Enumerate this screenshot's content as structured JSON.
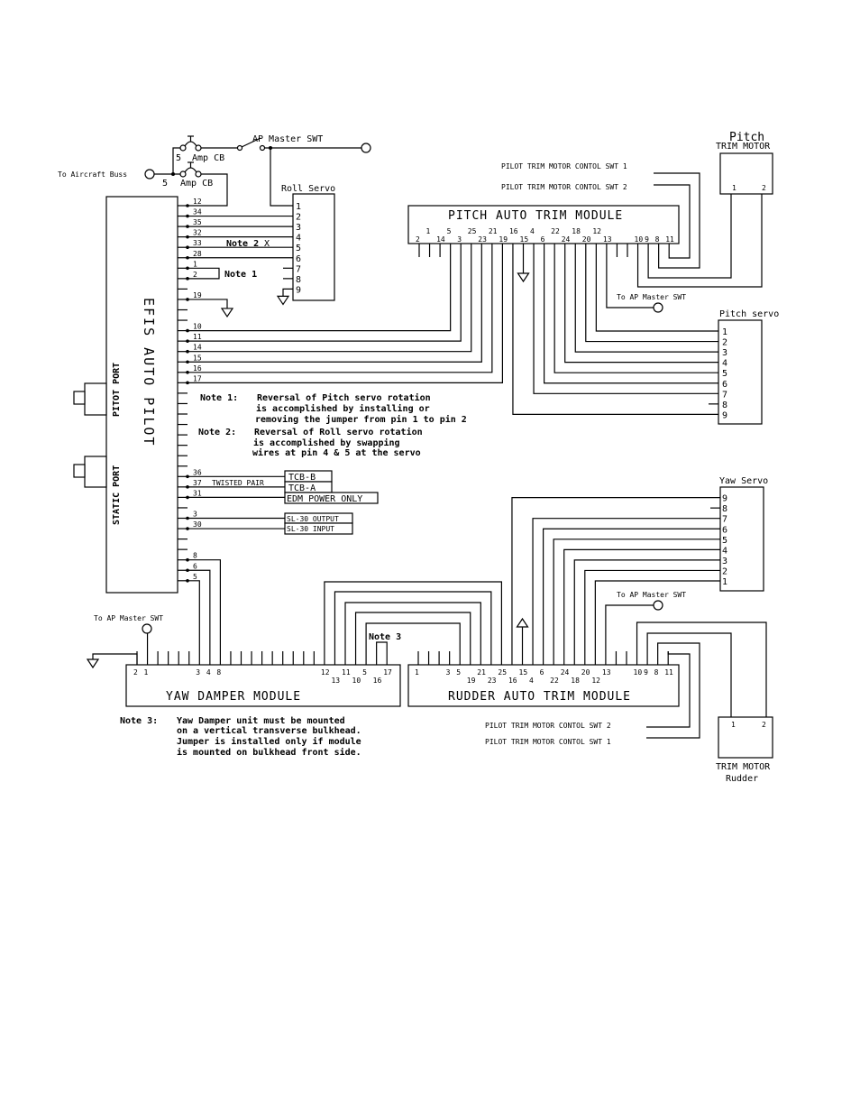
{
  "power": {
    "aircraft_buss": "To Aircraft Buss",
    "cb_top_amps": "5",
    "cb_top_label": "Amp CB",
    "cb_bottom_amps": "5",
    "cb_bottom_label": "Amp CB",
    "ap_master": "AP Master SWT"
  },
  "efis": {
    "title": "EFIS AUTO PILOT",
    "pitot_port": "PITOT PORT",
    "static_port": "STATIC PORT",
    "pins": [
      "12",
      "34",
      "35",
      "32",
      "33",
      "28",
      "1",
      "2",
      "",
      "19",
      "",
      "",
      "10",
      "11",
      "14",
      "15",
      "16",
      "17",
      "",
      "",
      "",
      "",
      "",
      "",
      "",
      "",
      "36",
      "37",
      "31",
      "",
      "3",
      "30",
      "",
      "",
      "8",
      "6",
      "5"
    ]
  },
  "roll_servo": {
    "title": "Roll Servo",
    "pins": [
      "1",
      "2",
      "3",
      "4",
      "5",
      "6",
      "7",
      "8",
      "9"
    ]
  },
  "inline_notes": {
    "note1": "Note 1",
    "note2": "Note 2",
    "note3": "Note 3"
  },
  "pitch_module": {
    "title": "PITCH AUTO TRIM MODULE",
    "pins": [
      "2",
      "1",
      "14",
      "5",
      "3",
      "25",
      "23",
      "21",
      "19",
      "16",
      "15",
      "4",
      "6",
      "22",
      "24",
      "18",
      "20",
      "12",
      "13",
      "",
      "",
      "10",
      "9",
      "8",
      "11"
    ]
  },
  "pitch_trim_motor": {
    "title": "Pitch",
    "subtitle": "TRIM MOTOR",
    "pins": [
      "1",
      "2"
    ]
  },
  "pitch_switches": {
    "swt1": "PILOT TRIM MOTOR CONTOL SWT 1",
    "swt2": "PILOT TRIM MOTOR CONTOL SWT 2"
  },
  "to_ap_master": {
    "pitch": "To AP Master SWT",
    "yaw_damper": "To AP Master SWT",
    "rudder": "To AP Master SWT"
  },
  "pitch_servo": {
    "title": "Pitch servo",
    "pins": [
      "1",
      "2",
      "3",
      "4",
      "5",
      "6",
      "7",
      "8",
      "9"
    ]
  },
  "notes": {
    "note1_label": "Note 1:",
    "note1_lines": [
      "Reversal of Pitch servo rotation",
      "is accomplished by installing or",
      "removing the jumper from pin 1 to pin 2"
    ],
    "note2_label": "Note 2:",
    "note2_lines": [
      "Reversal of Roll servo rotation",
      "is accomplished by swapping",
      "wires at pin 4 & 5 at the servo"
    ],
    "note3_label": "Note 3:",
    "note3_lines": [
      "Yaw Damper unit must be mounted",
      "on a vertical transverse bulkhead.",
      "Jumper is installed only if module",
      "is mounted on bulkhead front side."
    ]
  },
  "connections": {
    "twisted_pair": "TWISTED PAIR",
    "tcb_b": "TCB-B",
    "tcb_a": "TCB-A",
    "edm": "EDM POWER ONLY",
    "sl30_out": "SL-30 OUTPUT",
    "sl30_in": "SL-30 INPUT"
  },
  "yaw_servo": {
    "title": "Yaw Servo",
    "pins": [
      "9",
      "8",
      "7",
      "6",
      "5",
      "4",
      "3",
      "2",
      "1"
    ]
  },
  "yaw_damper": {
    "title": "YAW DAMPER MODULE",
    "pins": [
      "2",
      "1",
      "",
      "",
      "",
      "",
      "3",
      "4",
      "8",
      "",
      "",
      "",
      "",
      "",
      "",
      "",
      "",
      "",
      "12",
      "13",
      "11",
      "10",
      "5",
      "16",
      "17"
    ]
  },
  "rudder_module": {
    "title": "RUDDER AUTO TRIM MODULE",
    "pins": [
      "1",
      "",
      "",
      "3",
      "5",
      "19",
      "21",
      "23",
      "25",
      "16",
      "15",
      "4",
      "6",
      "22",
      "24",
      "18",
      "20",
      "12",
      "13",
      "",
      "",
      "10",
      "9",
      "8",
      "11"
    ]
  },
  "rudder_switches": {
    "swt2": "PILOT TRIM MOTOR CONTOL SWT 2",
    "swt1": "PILOT TRIM MOTOR CONTOL SWT 1"
  },
  "rudder_trim_motor": {
    "title": "TRIM MOTOR",
    "subtitle": "Rudder",
    "pins": [
      "1",
      "2"
    ]
  }
}
